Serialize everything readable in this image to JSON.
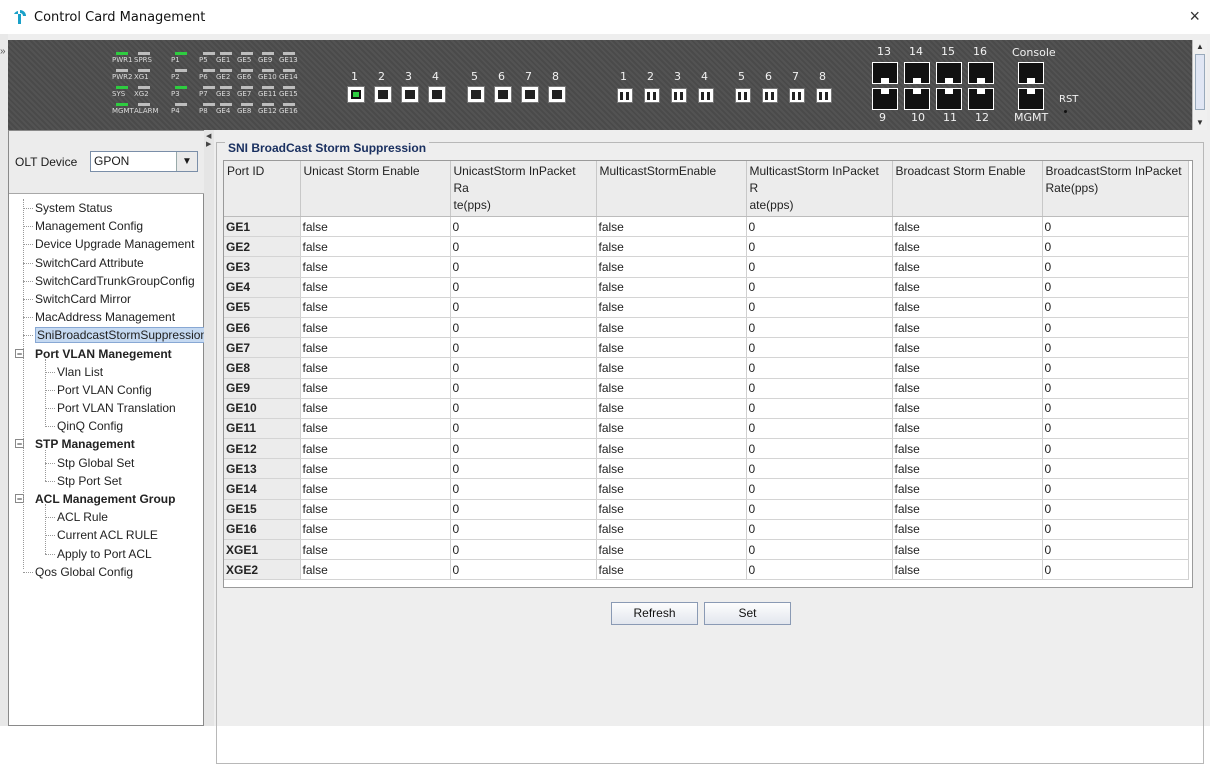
{
  "window": {
    "title": "Control Card Management",
    "close": "×"
  },
  "device": {
    "leds": [
      "PWR1",
      "SPRS",
      "P1",
      "P5",
      "GE1",
      "GE5",
      "GE9",
      "GE13",
      "PWR2",
      "XG1",
      "P2",
      "P6",
      "GE2",
      "GE6",
      "GE10",
      "GE14",
      "SYS",
      "XG2",
      "P3",
      "P7",
      "GE3",
      "GE7",
      "GE11",
      "GE15",
      "MGMT",
      "ALARM",
      "P4",
      "P8",
      "GE4",
      "GE8",
      "GE12",
      "GE16"
    ],
    "pon_numbers": [
      "1",
      "2",
      "3",
      "4",
      "5",
      "6",
      "7",
      "8"
    ],
    "uplink_numbers": [
      "1",
      "2",
      "3",
      "4",
      "5",
      "6",
      "7",
      "8"
    ],
    "rj_top_numbers": [
      "13",
      "14",
      "15",
      "16"
    ],
    "rj_bottom_numbers": [
      "9",
      "10",
      "11",
      "12"
    ],
    "console_label": "Console",
    "mgmt_label": "MGMT",
    "rst_label": "RST"
  },
  "sidebar": {
    "olt_label": "OLT Device",
    "olt_value": "GPON",
    "tree": [
      {
        "label": "System Status",
        "level": 1
      },
      {
        "label": "Management Config",
        "level": 1
      },
      {
        "label": "Device Upgrade Management",
        "level": 1
      },
      {
        "label": "SwitchCard Attribute",
        "level": 1
      },
      {
        "label": "SwitchCardTrunkGroupConfig",
        "level": 1
      },
      {
        "label": "SwitchCard Mirror",
        "level": 1
      },
      {
        "label": "MacAddress Management",
        "level": 1
      },
      {
        "label": "SniBroadcastStormSuppression",
        "level": 1,
        "selected": true
      },
      {
        "label": "Port VLAN Manegement",
        "level": 0
      },
      {
        "label": "Vlan List",
        "level": 2
      },
      {
        "label": "Port VLAN Config",
        "level": 2
      },
      {
        "label": "Port VLAN Translation",
        "level": 2
      },
      {
        "label": "QinQ Config",
        "level": 2
      },
      {
        "label": "STP Management",
        "level": 0
      },
      {
        "label": "Stp Global Set",
        "level": 2
      },
      {
        "label": "Stp Port Set",
        "level": 2
      },
      {
        "label": "ACL Management Group",
        "level": 0
      },
      {
        "label": "ACL Rule",
        "level": 2
      },
      {
        "label": "Current ACL RULE",
        "level": 2
      },
      {
        "label": "Apply to Port ACL",
        "level": 2
      },
      {
        "label": "Qos Global Config",
        "level": 1
      }
    ]
  },
  "panel": {
    "legend": "SNI BroadCast Storm Suppression",
    "columns": [
      {
        "line1": "Port ID",
        "line2": ""
      },
      {
        "line1": "Unicast Storm Enable",
        "line2": ""
      },
      {
        "line1": "UnicastStorm InPacket Ra",
        "line2": "te(pps)"
      },
      {
        "line1": "MulticastStormEnable",
        "line2": ""
      },
      {
        "line1": "MulticastStorm InPacket R",
        "line2": "ate(pps)"
      },
      {
        "line1": "Broadcast Storm Enable",
        "line2": ""
      },
      {
        "line1": "BroadcastStorm InPacket",
        "line2": "Rate(pps)"
      }
    ],
    "rows": [
      [
        "GE1",
        "false",
        "0",
        "false",
        "0",
        "false",
        "0"
      ],
      [
        "GE2",
        "false",
        "0",
        "false",
        "0",
        "false",
        "0"
      ],
      [
        "GE3",
        "false",
        "0",
        "false",
        "0",
        "false",
        "0"
      ],
      [
        "GE4",
        "false",
        "0",
        "false",
        "0",
        "false",
        "0"
      ],
      [
        "GE5",
        "false",
        "0",
        "false",
        "0",
        "false",
        "0"
      ],
      [
        "GE6",
        "false",
        "0",
        "false",
        "0",
        "false",
        "0"
      ],
      [
        "GE7",
        "false",
        "0",
        "false",
        "0",
        "false",
        "0"
      ],
      [
        "GE8",
        "false",
        "0",
        "false",
        "0",
        "false",
        "0"
      ],
      [
        "GE9",
        "false",
        "0",
        "false",
        "0",
        "false",
        "0"
      ],
      [
        "GE10",
        "false",
        "0",
        "false",
        "0",
        "false",
        "0"
      ],
      [
        "GE11",
        "false",
        "0",
        "false",
        "0",
        "false",
        "0"
      ],
      [
        "GE12",
        "false",
        "0",
        "false",
        "0",
        "false",
        "0"
      ],
      [
        "GE13",
        "false",
        "0",
        "false",
        "0",
        "false",
        "0"
      ],
      [
        "GE14",
        "false",
        "0",
        "false",
        "0",
        "false",
        "0"
      ],
      [
        "GE15",
        "false",
        "0",
        "false",
        "0",
        "false",
        "0"
      ],
      [
        "GE16",
        "false",
        "0",
        "false",
        "0",
        "false",
        "0"
      ],
      [
        "XGE1",
        "false",
        "0",
        "false",
        "0",
        "false",
        "0"
      ],
      [
        "XGE2",
        "false",
        "0",
        "false",
        "0",
        "false",
        "0"
      ]
    ],
    "refresh_label": "Refresh",
    "set_label": "Set"
  },
  "colors": {
    "led_on": "#2ecc40",
    "accent": "#1a3060",
    "selected": "#c5d9f1"
  },
  "icons": {
    "app": "tplink-logo-icon",
    "close": "close-icon",
    "combo": "chevron-down-icon"
  }
}
